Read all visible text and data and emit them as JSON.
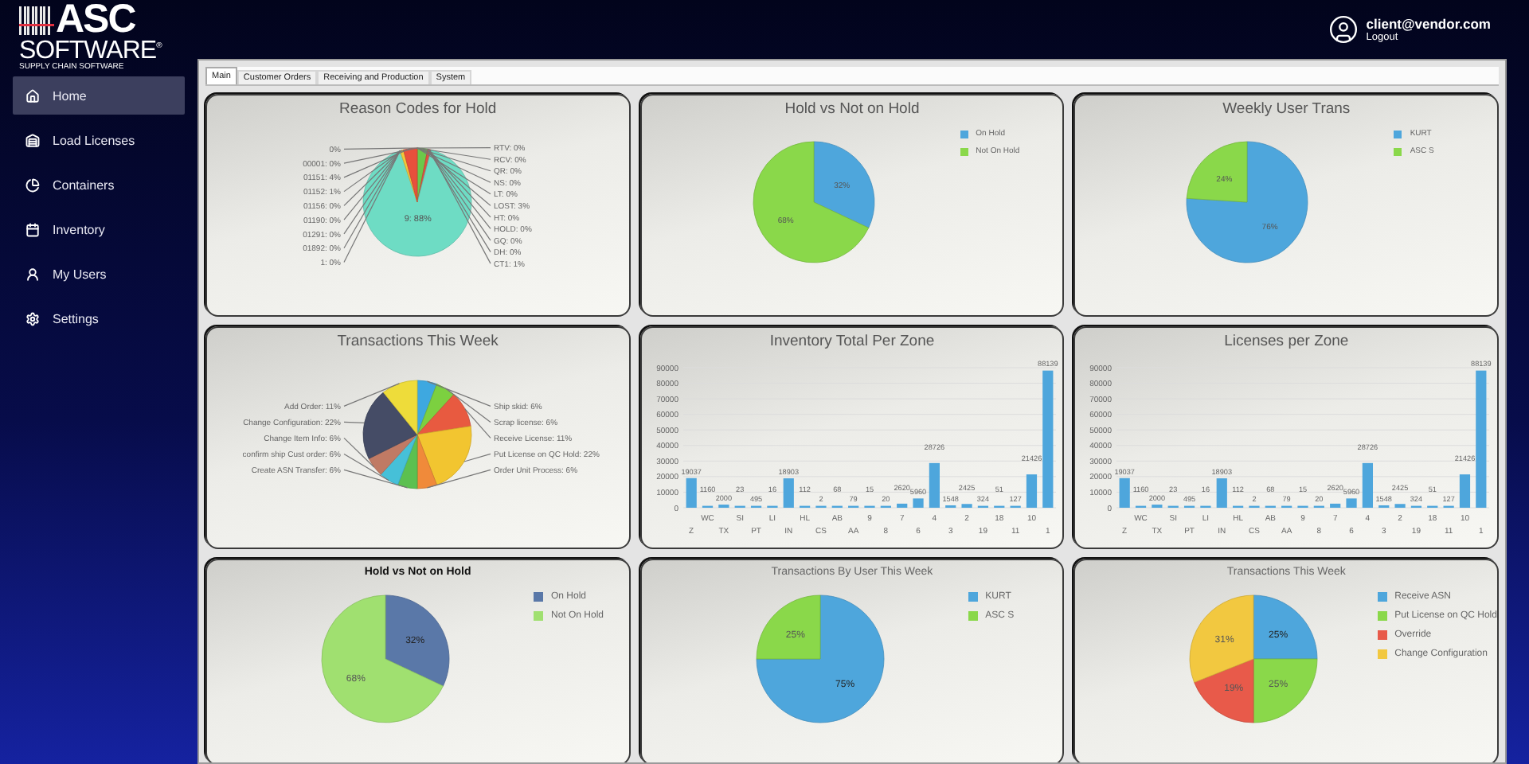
{
  "logo": {
    "name": "ASC",
    "line": "SOFTWARE$^{®}$",
    "tagline": "SUPPLY CHAIN SOFTWARE"
  },
  "user": {
    "email": "client@vendor.com",
    "action": "Logout"
  },
  "nav": [
    {
      "label": "Home",
      "selected": true
    },
    {
      "label": "Load Licenses",
      "selected": false
    },
    {
      "label": "Containers",
      "selected": false
    },
    {
      "label": "Inventory",
      "selected": false
    },
    {
      "label": "My Users",
      "selected": false
    },
    {
      "label": "Settings",
      "selected": false
    }
  ],
  "tabs": [
    {
      "label": "Main",
      "selected": true
    },
    {
      "label": "Customer Orders",
      "selected": false
    },
    {
      "label": "Receiving and Production",
      "selected": false
    },
    {
      "label": "System",
      "selected": false
    }
  ],
  "rows": [
    [
      {
        "kind": "labeled_pie",
        "chart_data": {
          "type": "pie",
          "title": "Reason Codes for Hold",
          "data_labels": true,
          "values": [
            0,
            0,
            0,
            0,
            0,
            3,
            0,
            0,
            0,
            0,
            1,
            88,
            0,
            0,
            0,
            0,
            0,
            1,
            4,
            0,
            0
          ],
          "colors": [
            "#9a9a9a",
            "#9a9a9a",
            "#9a9a9a",
            "#9a9a9a",
            "#9a9a9a",
            "#6cc84a",
            "#9a9a9a",
            "#9a9a9a",
            "#9a9a9a",
            "#9a9a9a",
            "#e05040",
            "#6edcc4",
            "#9a9a9a",
            "#9a9a9a",
            "#9a9a9a",
            "#9a9a9a",
            "#9a9a9a",
            "#f2c83a",
            "#e8503c",
            "#9a9a9a",
            "#9a9a9a"
          ],
          "value_labels": [
            "RTV: 0%",
            "RCV: 0%",
            "QR: 0%",
            "NS: 0%",
            "LT: 0%",
            "LOST: 3%",
            "HT: 0%",
            "HOLD: 0%",
            "GQ: 0%",
            "DH: 0%",
            "CT1: 1%",
            "9: 88%",
            "1: 0%",
            "01892: 0%",
            "01291: 0%",
            "01190: 0%",
            "01156: 0%",
            "01152: 1%",
            "01151: 4%",
            "00001: 0%",
            "0%"
          ]
        }
      },
      {
        "kind": "pie",
        "chart_data": {
          "type": "pie",
          "title": "Hold vs Not on Hold",
          "data_labels": true,
          "legend": "right",
          "categories": [
            "On Hold",
            "Not On Hold"
          ],
          "values": [
            32,
            68
          ],
          "colors": [
            "#4ea6dc",
            "#8ad84a"
          ],
          "value_labels": [
            "32%",
            "68%"
          ]
        }
      },
      {
        "kind": "pie",
        "chart_data": {
          "type": "pie",
          "title": "Weekly User Trans",
          "data_labels": true,
          "legend": "right",
          "categories": [
            "KURT",
            "ASC S"
          ],
          "values": [
            76,
            24
          ],
          "colors": [
            "#4ea6dc",
            "#8ad84a"
          ],
          "value_labels": [
            "76%",
            "24%"
          ]
        }
      }
    ],
    [
      {
        "kind": "labeled_pie",
        "chart_data": {
          "type": "pie",
          "title": "Transactions This Week",
          "data_labels": true,
          "values": [
            6,
            6,
            11,
            22,
            6,
            6,
            6,
            6,
            22,
            11
          ],
          "colors": [
            "#3ea8e0",
            "#7cd040",
            "#e85a40",
            "#f2c530",
            "#f08a3a",
            "#5cc050",
            "#46c0d8",
            "#c07a64",
            "#454c66",
            "#eedc3a"
          ],
          "value_labels": [
            "Ship skid: 6%",
            "Scrap license: 6%",
            "Receive License: 11%",
            "Put License on QC Hold: 22%",
            "Order Unit Process: 6%",
            "Create ASN Transfer: 6%",
            "confirm ship Cust order: 6%",
            "Change Item Info: 6%",
            "Change Configuration: 22%",
            "Add Order: 11%"
          ]
        }
      },
      {
        "kind": "bar",
        "chart_data": {
          "type": "bar",
          "title": "Inventory Total Per Zone",
          "data_labels": true,
          "categories": [
            "Z",
            "WC",
            "TX",
            "SI",
            "PT",
            "LI",
            "IN",
            "HL",
            "CS",
            "AB",
            "AA",
            "9",
            "8",
            "7",
            "6",
            "4",
            "3",
            "2",
            "19",
            "18",
            "11",
            "10",
            "1"
          ],
          "ylim": [
            0,
            90000
          ],
          "grid": true,
          "yticks": [
            0,
            10000,
            20000,
            30000,
            40000,
            50000,
            60000,
            70000,
            80000,
            90000
          ],
          "series": [
            {
              "color": "#4ea6dc",
              "values": [
                19037,
                1160,
                2000,
                23,
                495,
                16,
                18903,
                112,
                2,
                68,
                79,
                15,
                20,
                2620,
                5960,
                28726,
                1548,
                2425,
                324,
                51,
                127,
                21426,
                88139
              ]
            }
          ]
        }
      },
      {
        "kind": "bar",
        "chart_data": {
          "type": "bar",
          "title": "Licenses per Zone",
          "data_labels": true,
          "categories": [
            "Z",
            "WC",
            "TX",
            "SI",
            "PT",
            "LI",
            "IN",
            "HL",
            "CS",
            "AB",
            "AA",
            "9",
            "8",
            "7",
            "6",
            "4",
            "3",
            "2",
            "19",
            "18",
            "11",
            "10",
            "1"
          ],
          "ylim": [
            0,
            90000
          ],
          "grid": true,
          "yticks": [
            0,
            10000,
            20000,
            30000,
            40000,
            50000,
            60000,
            70000,
            80000,
            90000
          ],
          "series": [
            {
              "color": "#4ea6dc",
              "values": [
                19037,
                1160,
                2000,
                23,
                495,
                16,
                18903,
                112,
                2,
                68,
                79,
                15,
                20,
                2620,
                5960,
                28726,
                1548,
                2425,
                324,
                51,
                127,
                21426,
                88139
              ]
            }
          ]
        }
      }
    ],
    [
      {
        "kind": "pie",
        "chart_data": {
          "type": "pie",
          "title": "Hold vs Not on Hold",
          "data_labels": true,
          "legend": "right",
          "categories": [
            "On Hold",
            "Not On Hold"
          ],
          "values": [
            32,
            68
          ],
          "colors": [
            "#5a78a8",
            "#a0e070"
          ],
          "value_labels": [
            "32%",
            "68%"
          ]
        }
      },
      {
        "kind": "pie",
        "chart_data": {
          "type": "pie",
          "title": "Transactions By User This Week",
          "data_labels": true,
          "legend": "right",
          "categories": [
            "KURT",
            "ASC S"
          ],
          "values": [
            75,
            25
          ],
          "colors": [
            "#4ea6dc",
            "#8ad84a"
          ],
          "value_labels": [
            "75%",
            "25%"
          ]
        }
      },
      {
        "kind": "pie",
        "chart_data": {
          "type": "pie",
          "title": "Transactions This Week",
          "data_labels": true,
          "legend": "right",
          "categories": [
            "Receive ASN",
            "Put License on QC Hold",
            "Override",
            "Change Configuration"
          ],
          "values": [
            25,
            25,
            19,
            31
          ],
          "colors": [
            "#4ea6dc",
            "#8ad84a",
            "#e85a4a",
            "#f2c840"
          ],
          "value_labels": [
            "25%",
            "25%",
            "19%",
            "31%"
          ]
        }
      }
    ]
  ]
}
